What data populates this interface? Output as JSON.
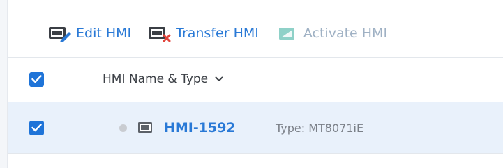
{
  "toolbar": {
    "edit_label": "Edit HMI",
    "transfer_label": "Transfer HMI",
    "activate_label": "Activate HMI"
  },
  "table": {
    "header": {
      "column_name": "HMI Name & Type",
      "select_all_checked": true
    },
    "rows": [
      {
        "checked": true,
        "status": "offline",
        "name": "HMI-1592",
        "type": "Type: MT8071iE"
      }
    ]
  },
  "colors": {
    "accent": "#2979d6",
    "checkbox": "#1f74d8",
    "row_selected_bg": "#e9f1fb",
    "activate_disabled": "#9fb1c4",
    "transfer_badge": "#e2453c"
  },
  "icons": {
    "edit": "edit-hmi-icon",
    "transfer": "transfer-hmi-icon",
    "activate": "activate-hmi-icon",
    "header_sort": "chevron-down-icon",
    "row_device": "hmi-device-icon",
    "row_status": "status-dot-icon"
  }
}
